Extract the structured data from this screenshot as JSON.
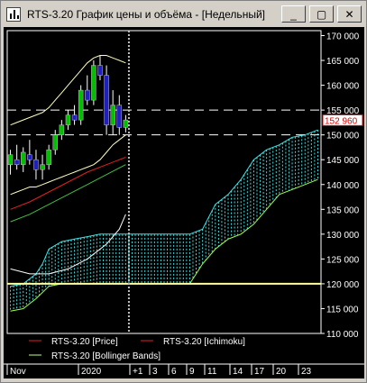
{
  "window": {
    "title": "RTS-3.20 График цены и объёма - [Недельный]"
  },
  "buttons": {
    "minimize": "_",
    "restore": "▢",
    "close": "✕"
  },
  "colors": {
    "background": "#000000",
    "axis": "#ffffff",
    "candle_up": "#00c000",
    "candle_down": "#2020c0",
    "bollinger": "#ffffc0",
    "price_line": "#e02020",
    "cloud_top": "#40e0e0",
    "cloud_bottom": "#a0ff40",
    "current_price_box": "#e00000"
  },
  "price_axis": {
    "ticks": [
      "170 000",
      "165 000",
      "160 000",
      "155 000",
      "150 000",
      "145 000",
      "140 000",
      "135 000",
      "130 000",
      "125 000",
      "120 000",
      "115 000",
      "110 000"
    ],
    "current_price": "152 960"
  },
  "time_axis": {
    "labels": [
      "Nov",
      "2020",
      "+1",
      "3",
      "6",
      "9",
      "11",
      "14",
      "17",
      "20",
      "23"
    ]
  },
  "legend": [
    {
      "label": "RTS-3.20 [Price]",
      "color": "#e02020"
    },
    {
      "label": "RTS-3.20 [Ichimoku]",
      "color": "#e02020"
    },
    {
      "label": "RTS-3.20 [Bollinger Bands]",
      "color": "#c0ff80"
    }
  ],
  "chart_data": {
    "type": "line",
    "symbol": "RTS-3.20",
    "timeframe": "weekly",
    "ylim": [
      110000,
      171000
    ],
    "candles": [
      {
        "o": 144000,
        "h": 147000,
        "l": 142000,
        "c": 146000
      },
      {
        "o": 145000,
        "h": 148000,
        "l": 143000,
        "c": 144000
      },
      {
        "o": 144000,
        "h": 147500,
        "l": 142500,
        "c": 146500
      },
      {
        "o": 146000,
        "h": 149000,
        "l": 144000,
        "c": 145000
      },
      {
        "o": 145000,
        "h": 147000,
        "l": 141000,
        "c": 143000
      },
      {
        "o": 143000,
        "h": 146000,
        "l": 141000,
        "c": 144000
      },
      {
        "o": 144000,
        "h": 148000,
        "l": 143000,
        "c": 147000
      },
      {
        "o": 147000,
        "h": 151000,
        "l": 146000,
        "c": 150000
      },
      {
        "o": 150000,
        "h": 153000,
        "l": 149000,
        "c": 152000
      },
      {
        "o": 152000,
        "h": 155000,
        "l": 151000,
        "c": 154000
      },
      {
        "o": 154000,
        "h": 156000,
        "l": 152000,
        "c": 153000
      },
      {
        "o": 153000,
        "h": 160000,
        "l": 152000,
        "c": 159000
      },
      {
        "o": 159000,
        "h": 162000,
        "l": 156000,
        "c": 157000
      },
      {
        "o": 157000,
        "h": 165000,
        "l": 156000,
        "c": 164000
      },
      {
        "o": 164000,
        "h": 166000,
        "l": 161000,
        "c": 162000
      },
      {
        "o": 162000,
        "h": 164000,
        "l": 150000,
        "c": 152000
      },
      {
        "o": 152000,
        "h": 159000,
        "l": 150000,
        "c": 156000
      },
      {
        "o": 156000,
        "h": 158000,
        "l": 150000,
        "c": 151500
      },
      {
        "o": 151500,
        "h": 154000,
        "l": 150500,
        "c": 153000
      }
    ],
    "bollinger_upper": [
      152000,
      152500,
      153000,
      153500,
      154000,
      154500,
      155500,
      157000,
      158500,
      160000,
      161500,
      163000,
      164500,
      165500,
      166000,
      166000,
      165500,
      165000,
      164500
    ],
    "bollinger_lower": [
      138000,
      138500,
      139000,
      139500,
      139500,
      140000,
      140500,
      141000,
      141500,
      142000,
      142500,
      143000,
      143500,
      144000,
      145000,
      146500,
      148000,
      149000,
      150000
    ],
    "bollinger_lower_ext": [
      {
        "x": 0,
        "y": 132500
      },
      {
        "x": 3,
        "y": 134000
      },
      {
        "x": 6,
        "y": 136000
      },
      {
        "x": 9,
        "y": 138000
      },
      {
        "x": 12,
        "y": 140000
      },
      {
        "x": 15,
        "y": 142000
      },
      {
        "x": 18,
        "y": 144000
      }
    ],
    "price_red": [
      {
        "x": 0,
        "y": 135000
      },
      {
        "x": 3,
        "y": 136500
      },
      {
        "x": 6,
        "y": 138500
      },
      {
        "x": 9,
        "y": 140500
      },
      {
        "x": 12,
        "y": 142500
      },
      {
        "x": 15,
        "y": 144000
      },
      {
        "x": 18,
        "y": 145500
      }
    ],
    "lower_band_curve": [
      {
        "x": 0,
        "y": 123000
      },
      {
        "x": 3,
        "y": 122000
      },
      {
        "x": 6,
        "y": 122000
      },
      {
        "x": 9,
        "y": 123000
      },
      {
        "x": 12,
        "y": 125000
      },
      {
        "x": 15,
        "y": 128000
      },
      {
        "x": 17,
        "y": 131000
      },
      {
        "x": 18,
        "y": 134000
      }
    ],
    "cloud_top": [
      {
        "x": 0,
        "y": 119500
      },
      {
        "x": 2,
        "y": 120000
      },
      {
        "x": 4,
        "y": 122000
      },
      {
        "x": 5,
        "y": 124000
      },
      {
        "x": 6,
        "y": 127000
      },
      {
        "x": 8,
        "y": 128500
      },
      {
        "x": 10,
        "y": 129000
      },
      {
        "x": 12,
        "y": 129500
      },
      {
        "x": 14,
        "y": 130000
      },
      {
        "x": 16,
        "y": 130000
      },
      {
        "x": 18,
        "y": 130000
      },
      {
        "x": 20,
        "y": 130000
      },
      {
        "x": 24,
        "y": 130000
      },
      {
        "x": 28,
        "y": 130000
      },
      {
        "x": 30,
        "y": 131000
      },
      {
        "x": 32,
        "y": 136000
      },
      {
        "x": 34,
        "y": 138000
      },
      {
        "x": 36,
        "y": 141000
      },
      {
        "x": 38,
        "y": 145000
      },
      {
        "x": 40,
        "y": 147000
      },
      {
        "x": 42,
        "y": 148000
      },
      {
        "x": 44,
        "y": 149500
      },
      {
        "x": 46,
        "y": 150000
      },
      {
        "x": 48,
        "y": 151000
      }
    ],
    "cloud_bottom": [
      {
        "x": 0,
        "y": 114500
      },
      {
        "x": 2,
        "y": 115000
      },
      {
        "x": 4,
        "y": 117000
      },
      {
        "x": 6,
        "y": 119500
      },
      {
        "x": 8,
        "y": 120000
      },
      {
        "x": 10,
        "y": 120000
      },
      {
        "x": 12,
        "y": 120000
      },
      {
        "x": 16,
        "y": 120000
      },
      {
        "x": 20,
        "y": 120000
      },
      {
        "x": 24,
        "y": 120000
      },
      {
        "x": 28,
        "y": 120000
      },
      {
        "x": 30,
        "y": 124000
      },
      {
        "x": 32,
        "y": 127000
      },
      {
        "x": 34,
        "y": 129000
      },
      {
        "x": 36,
        "y": 130000
      },
      {
        "x": 38,
        "y": 132000
      },
      {
        "x": 40,
        "y": 135000
      },
      {
        "x": 42,
        "y": 138000
      },
      {
        "x": 44,
        "y": 139000
      },
      {
        "x": 46,
        "y": 140000
      },
      {
        "x": 48,
        "y": 141000
      }
    ],
    "horizontal_levels": [
      155000,
      150000,
      120000
    ],
    "current_price": 152960,
    "future_divider_x": 18.5,
    "total_slots": 49
  }
}
